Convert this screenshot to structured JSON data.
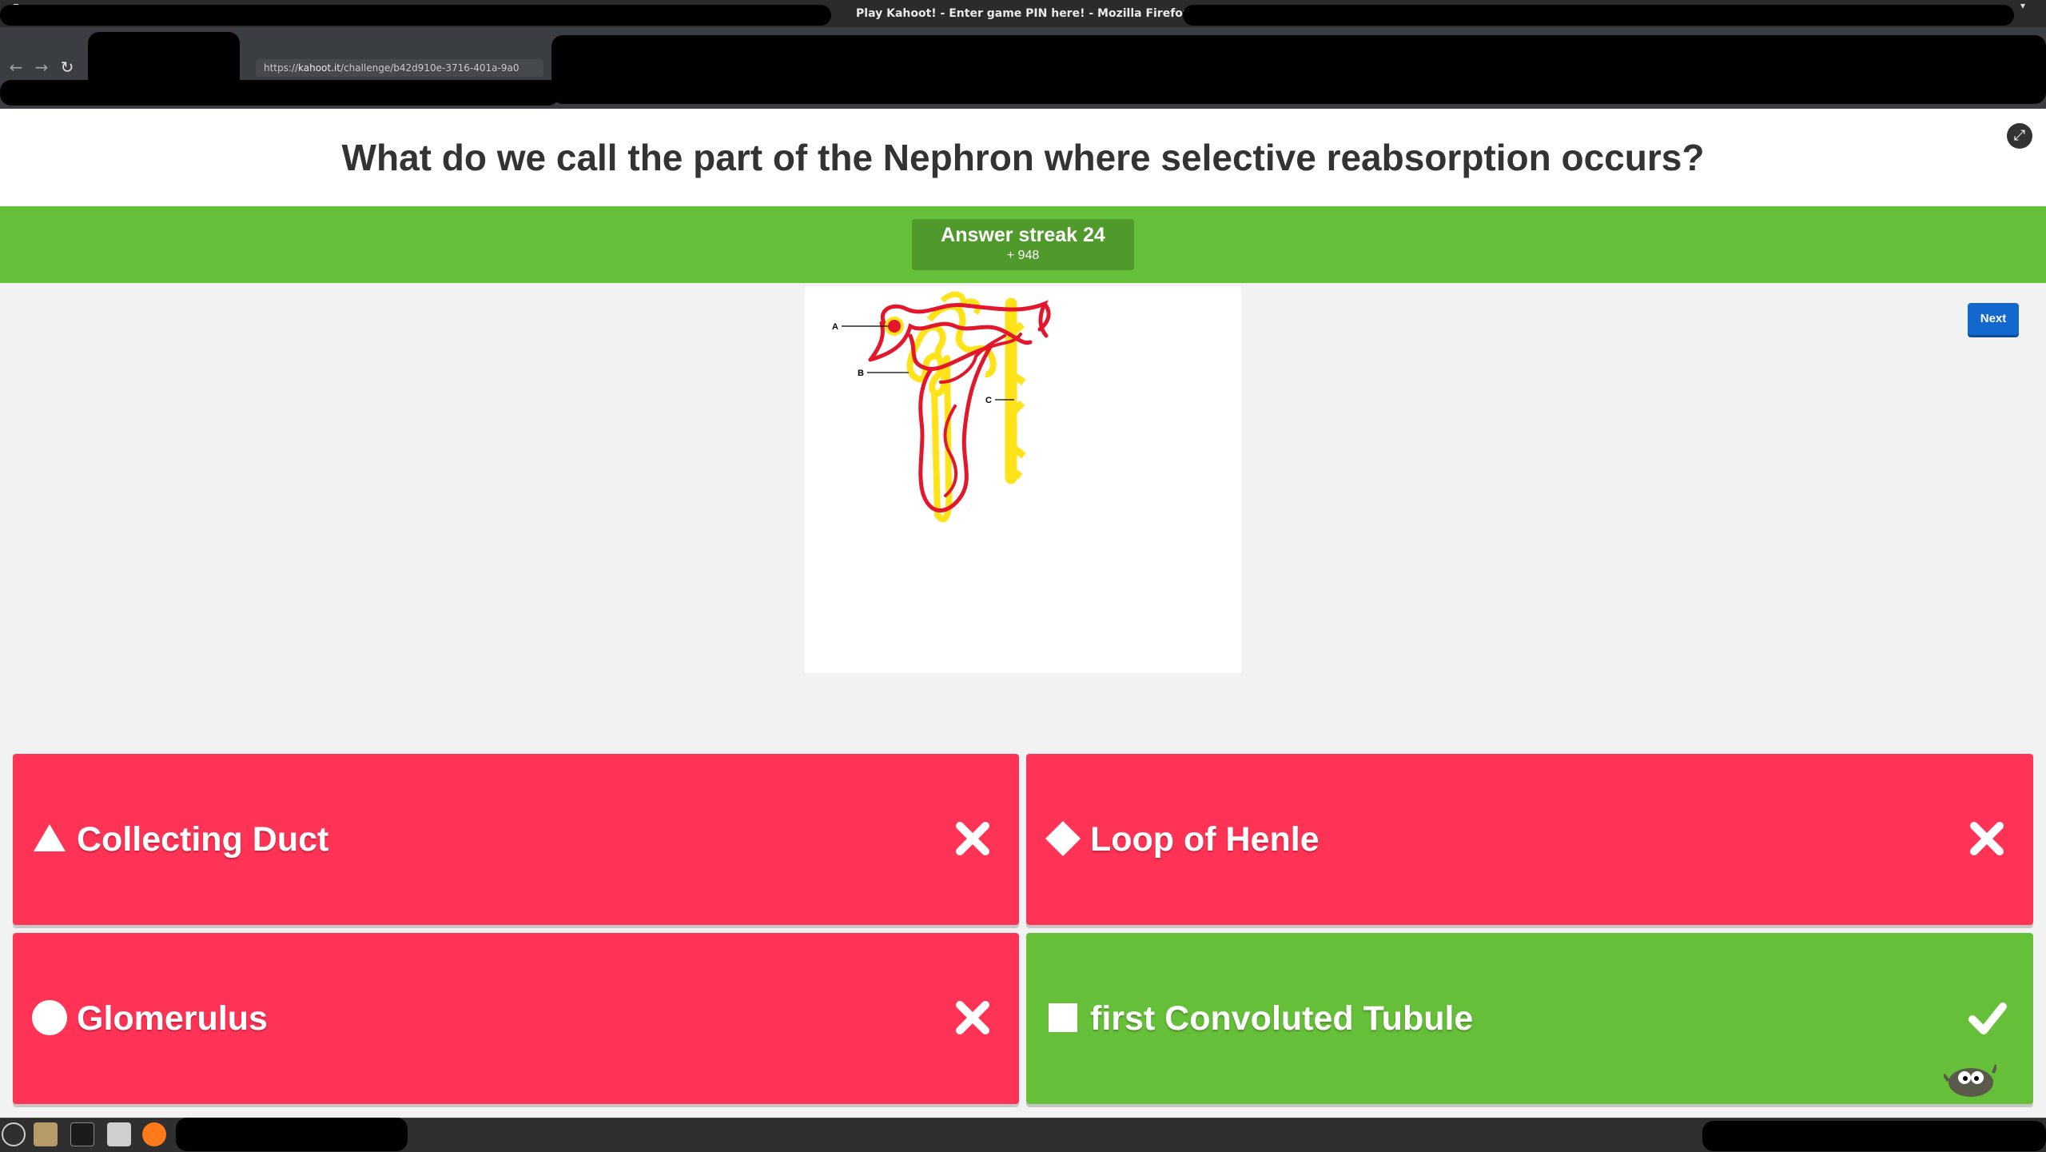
{
  "browser": {
    "window_title": "Play Kahoot! - Enter game PIN here! - Mozilla Firefox",
    "url_prefix": "https://",
    "url_host": "kahoot.it",
    "url_path": "/challenge/b42d910e-3716-401a-9a0"
  },
  "question": {
    "text": "What do we call the part of the Nephron where selective reabsorption  occurs?"
  },
  "streak": {
    "title": "Answer streak 24",
    "points": "+ 948"
  },
  "diagram": {
    "labels": [
      "A",
      "B",
      "C"
    ]
  },
  "next_label": "Next",
  "answers": [
    {
      "shape": "triangle",
      "label": "Collecting Duct",
      "correct": false
    },
    {
      "shape": "diamond",
      "label": "Loop of Henle",
      "correct": false
    },
    {
      "shape": "circle",
      "label": "Glomerulus",
      "correct": false
    },
    {
      "shape": "square",
      "label": "first Convoluted Tubule",
      "correct": true
    }
  ],
  "colors": {
    "wrong": "#ff3355",
    "correct": "#66bf39",
    "streak_bar": "#66bf39",
    "next_button": "#1368ce",
    "tubule_yellow": "#ffe31a",
    "vessel_red": "#e3172b"
  },
  "icons": {
    "wrong_mark": "cross-icon",
    "correct_mark": "check-icon",
    "fullscreen": "fullscreen-icon"
  }
}
